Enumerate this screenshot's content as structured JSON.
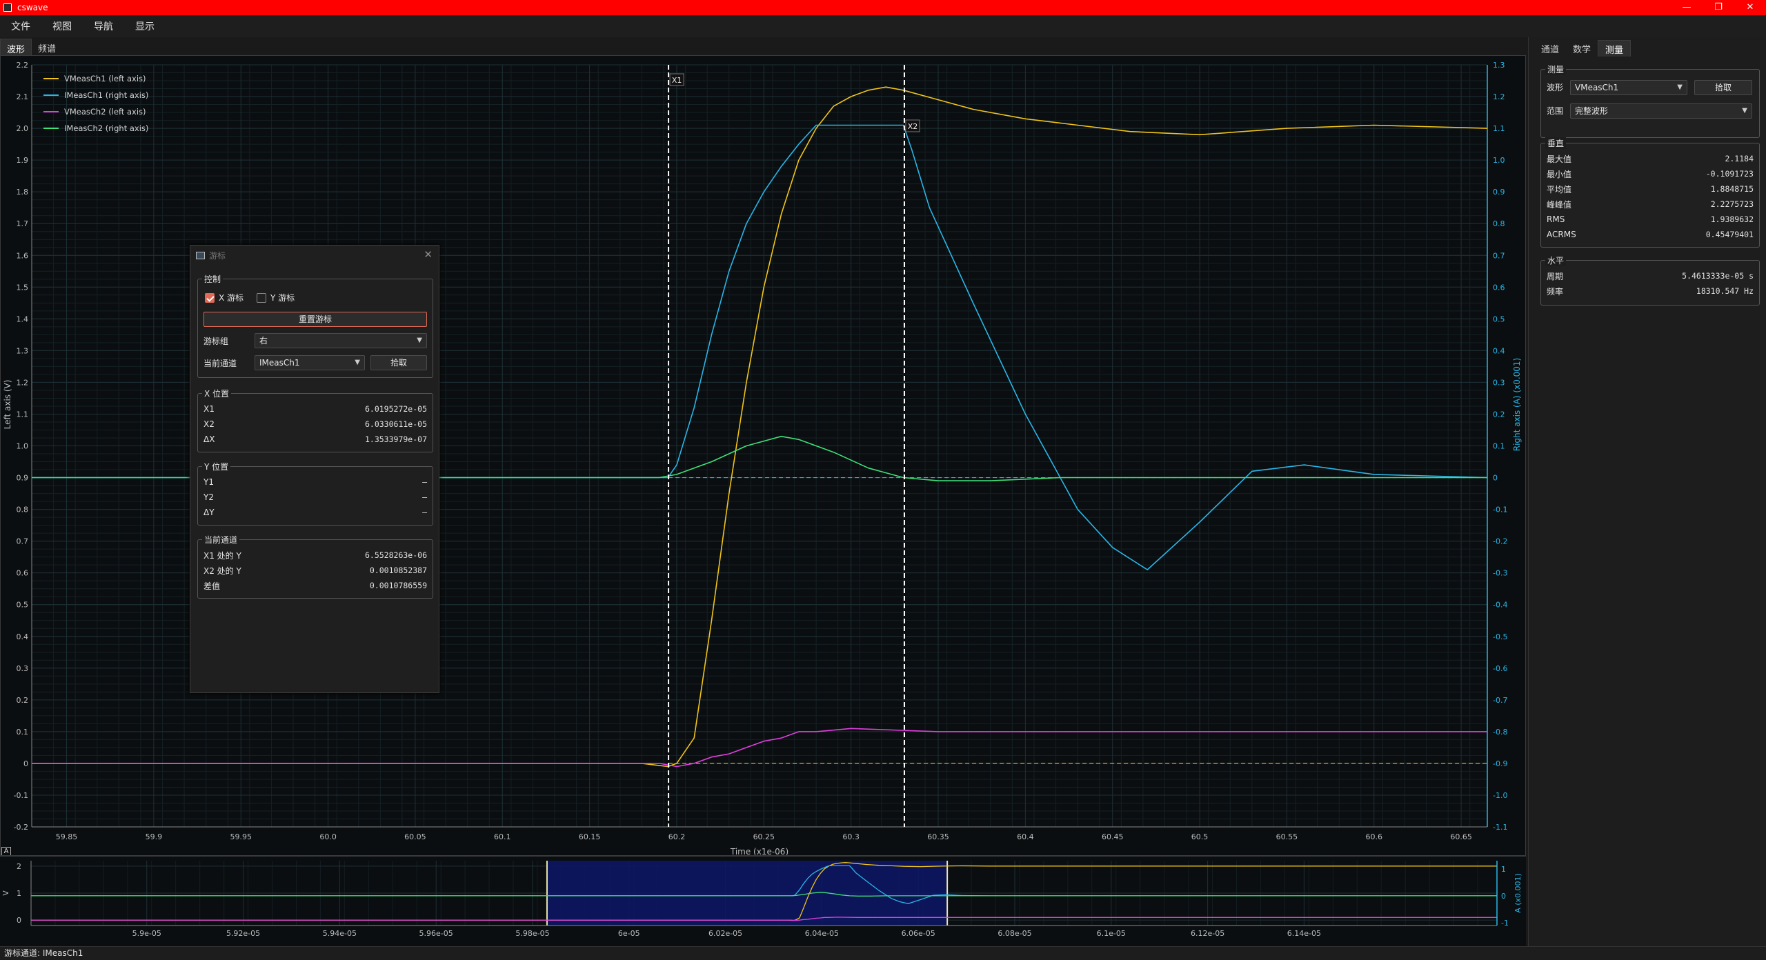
{
  "window": {
    "title": "cswave",
    "btn_minimize": "—",
    "btn_restore": "❐",
    "btn_close": "✕"
  },
  "menu": {
    "file": "文件",
    "view": "视图",
    "nav": "导航",
    "display": "显示"
  },
  "left_tabs": {
    "waveform": "波形",
    "spectrum": "频谱"
  },
  "right_tabs": {
    "channels": "通道",
    "math": "数学",
    "measure": "测量"
  },
  "measure": {
    "group_title": "测量",
    "waveform_label": "波形",
    "waveform_value": "VMeasCh1",
    "pick_button": "拾取",
    "range_label": "范围",
    "range_value": "完整波形"
  },
  "vertical": {
    "group_title": "垂直",
    "rows": [
      {
        "label": "最大值",
        "value": "2.1184"
      },
      {
        "label": "最小值",
        "value": "-0.1091723"
      },
      {
        "label": "平均值",
        "value": "1.8848715"
      },
      {
        "label": "峰峰值",
        "value": "2.2275723"
      },
      {
        "label": "RMS",
        "value": "1.9389632"
      },
      {
        "label": "ACRMS",
        "value": "0.45479401"
      }
    ]
  },
  "horizontal": {
    "group_title": "水平",
    "rows": [
      {
        "label": "周期",
        "value": "5.4613333e-05 s"
      },
      {
        "label": "频率",
        "value": "18310.547 Hz"
      }
    ]
  },
  "cursor_dialog": {
    "title": "游标",
    "close": "✕",
    "control_group": "控制",
    "x_cursor": "X 游标",
    "y_cursor": "Y 游标",
    "x_checked": true,
    "y_checked": false,
    "reset_button": "重置游标",
    "group_label": "游标组",
    "group_value": "右",
    "channel_label": "当前通道",
    "channel_value": "IMeasCh1",
    "pick_button": "拾取",
    "x_group": "X 位置",
    "x_rows": [
      {
        "label": "X1",
        "value": "6.0195272e-05"
      },
      {
        "label": "X2",
        "value": "6.0330611e-05"
      },
      {
        "label": "ΔX",
        "value": "1.3533979e-07"
      }
    ],
    "y_group": "Y 位置",
    "y_rows": [
      {
        "label": "Y1",
        "value": "—"
      },
      {
        "label": "Y2",
        "value": "—"
      },
      {
        "label": "ΔY",
        "value": "—"
      }
    ],
    "ch_group": "当前通道",
    "ch_rows": [
      {
        "label": "X1 处的 Y",
        "value": "6.5528263e-06"
      },
      {
        "label": "X2 处的 Y",
        "value": "0.0010852387"
      },
      {
        "label": "差值",
        "value": "0.0010786559"
      }
    ]
  },
  "status": {
    "text": "游标通道: IMeasCh1"
  },
  "range_indicator": "A",
  "colors": {
    "vmeas_ch1": "#f0c419",
    "imeas_ch1": "#29b6e8",
    "vmeas_ch2": "#e040e0",
    "imeas_ch2": "#3ee07a",
    "cursor": "#ffffff",
    "right_axis": "#29b6e8",
    "titlebar": "#ff0000"
  },
  "chart_data": [
    {
      "type": "line",
      "xlabel": "Time (x1e-06)",
      "ylabel": "Left axis (V)",
      "y2label": "Right axis (A) (x0.001)",
      "xlim": [
        59.83,
        60.665
      ],
      "ylim": [
        -0.2,
        2.2
      ],
      "y2lim": [
        -1.1,
        1.3
      ],
      "x_ticks": [
        59.85,
        59.9,
        59.95,
        60.0,
        60.05,
        60.1,
        60.15,
        60.2,
        60.25,
        60.3,
        60.35,
        60.4,
        60.45,
        60.5,
        60.55,
        60.6,
        60.65
      ],
      "x_tick_labels": [
        "59.85",
        "59.9",
        "59.95",
        "60.0",
        "60.05",
        "60.1",
        "60.15",
        "60.2",
        "60.25",
        "60.3",
        "60.35",
        "60.4",
        "60.45",
        "60.5",
        "60.55",
        "60.6",
        "60.65"
      ],
      "y_ticks": [
        -0.2,
        -0.1,
        0,
        0.1,
        0.2,
        0.3,
        0.4,
        0.5,
        0.6,
        0.7,
        0.8,
        0.9,
        1.0,
        1.1,
        1.2,
        1.3,
        1.4,
        1.5,
        1.6,
        1.7,
        1.8,
        1.9,
        2.0,
        2.1,
        2.2
      ],
      "y_tick_labels": [
        "-0.2",
        "-0.1",
        "0",
        "0.1",
        "0.2",
        "0.3",
        "0.4",
        "0.5",
        "0.6",
        "0.7",
        "0.8",
        "0.9",
        "1.0",
        "1.1",
        "1.2",
        "1.3",
        "1.4",
        "1.5",
        "1.6",
        "1.7",
        "1.8",
        "1.9",
        "2.0",
        "2.1",
        "2.2"
      ],
      "y2_ticks": [
        -1.1,
        -1.0,
        -0.9,
        -0.8,
        -0.7,
        -0.6,
        -0.5,
        -0.4,
        -0.3,
        -0.2,
        -0.1,
        0,
        0.1,
        0.2,
        0.3,
        0.4,
        0.5,
        0.6,
        0.7,
        0.8,
        0.9,
        1.0,
        1.1,
        1.2,
        1.3
      ],
      "y2_tick_labels": [
        "-1.1",
        "-1.0",
        "-0.9",
        "-0.8",
        "-0.7",
        "-0.6",
        "-0.5",
        "-0.4",
        "-0.3",
        "-0.2",
        "-0.1",
        "0",
        "0.1",
        "0.2",
        "0.3",
        "0.4",
        "0.5",
        "0.6",
        "0.7",
        "0.8",
        "0.9",
        "1.0",
        "1.1",
        "1.2",
        "1.3"
      ],
      "legend_position": "top-left",
      "grid": true,
      "cursors": [
        {
          "label": "X1",
          "x": 60.1953
        },
        {
          "label": "X2",
          "x": 60.3306
        }
      ],
      "series": [
        {
          "name": "VMeasCh1 (left axis)",
          "axis": "left",
          "x": [
            59.83,
            59.9,
            60.0,
            60.1,
            60.18,
            60.195,
            60.2,
            60.21,
            60.22,
            60.23,
            60.24,
            60.25,
            60.26,
            60.27,
            60.28,
            60.29,
            60.3,
            60.31,
            60.32,
            60.33,
            60.35,
            60.37,
            60.4,
            60.43,
            60.46,
            60.5,
            60.55,
            60.6,
            60.665
          ],
          "y": [
            0.0,
            0.0,
            0.0,
            0.0,
            0.0,
            -0.01,
            0.0,
            0.08,
            0.45,
            0.85,
            1.2,
            1.5,
            1.73,
            1.9,
            2.0,
            2.07,
            2.1,
            2.12,
            2.13,
            2.12,
            2.09,
            2.06,
            2.03,
            2.01,
            1.99,
            1.98,
            2.0,
            2.01,
            2.0
          ]
        },
        {
          "name": "IMeasCh1 (right axis)",
          "axis": "right",
          "x": [
            59.83,
            60.0,
            60.19,
            60.195,
            60.2,
            60.21,
            60.22,
            60.23,
            60.24,
            60.25,
            60.26,
            60.27,
            60.28,
            60.29,
            60.3,
            60.32,
            60.33,
            60.335,
            60.345,
            60.37,
            60.4,
            60.43,
            60.45,
            60.47,
            60.5,
            60.53,
            60.56,
            60.6,
            60.665
          ],
          "y": [
            0.0,
            0.0,
            0.0,
            0.0,
            0.04,
            0.22,
            0.45,
            0.65,
            0.8,
            0.9,
            0.98,
            1.05,
            1.11,
            1.11,
            1.11,
            1.11,
            1.11,
            1.03,
            0.85,
            0.55,
            0.2,
            -0.1,
            -0.22,
            -0.29,
            -0.14,
            0.02,
            0.04,
            0.01,
            0.0
          ]
        },
        {
          "name": "VMeasCh2 (left axis)",
          "axis": "left",
          "x": [
            59.83,
            60.0,
            60.19,
            60.2,
            60.21,
            60.22,
            60.23,
            60.24,
            60.25,
            60.26,
            60.27,
            60.28,
            60.3,
            60.35,
            60.4,
            60.45,
            60.5,
            60.55,
            60.6,
            60.665
          ],
          "y": [
            0.0,
            0.0,
            0.0,
            -0.01,
            0.0,
            0.02,
            0.03,
            0.05,
            0.07,
            0.08,
            0.1,
            0.1,
            0.11,
            0.1,
            0.1,
            0.1,
            0.1,
            0.1,
            0.1,
            0.1
          ]
        },
        {
          "name": "IMeasCh2 (right axis)",
          "axis": "right",
          "x": [
            59.83,
            60.0,
            60.19,
            60.2,
            60.22,
            60.24,
            60.26,
            60.27,
            60.29,
            60.31,
            60.33,
            60.35,
            60.38,
            60.42,
            60.5,
            60.6,
            60.665
          ],
          "y": [
            0.0,
            0.0,
            0.0,
            0.01,
            0.05,
            0.1,
            0.13,
            0.12,
            0.08,
            0.03,
            0.0,
            -0.01,
            -0.01,
            0.0,
            0.0,
            0.0,
            0.0
          ]
        }
      ]
    },
    {
      "type": "line",
      "ylabel": "V",
      "y2label": "A (x0.001)",
      "xlim": [
        59.876,
        60.18
      ],
      "ylim": [
        -0.2,
        2.2
      ],
      "y2lim": [
        -1.1,
        1.3
      ],
      "x_ticks": [
        59.9,
        59.92,
        59.94,
        59.96,
        59.98,
        60.0,
        60.02,
        60.04,
        60.06,
        60.08,
        60.1,
        60.12,
        60.14
      ],
      "x_tick_labels": [
        "5.9e-05",
        "5.92e-05",
        "5.94e-05",
        "5.96e-05",
        "5.98e-05",
        "6e-05",
        "6.02e-05",
        "6.04e-05",
        "6.06e-05",
        "6.08e-05",
        "6.1e-05",
        "6.12e-05",
        "6.14e-05"
      ],
      "y_ticks": [
        0,
        1,
        2
      ],
      "y_tick_labels": [
        "0",
        "1",
        "2"
      ],
      "y2_ticks": [
        -1,
        0,
        1
      ],
      "y2_tick_labels": [
        "-1",
        "0",
        "1"
      ],
      "selection": [
        59.983,
        60.066
      ]
    }
  ]
}
